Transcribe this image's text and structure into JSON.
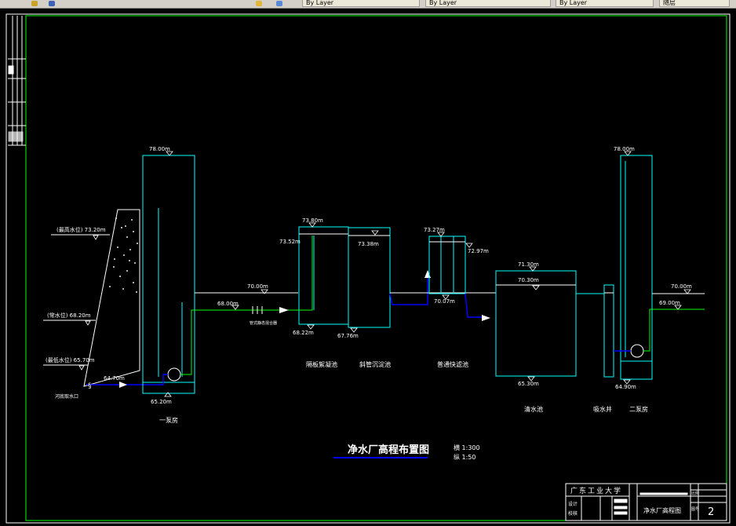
{
  "toolbar": {
    "tabs": [
      "By Layer",
      "By Layer",
      "By Layer",
      "随层"
    ],
    "icon_names": [
      "folder-icon",
      "save-icon",
      "layer-icon",
      "cube-icon"
    ]
  },
  "drawing": {
    "title": "净水厂高程布置图",
    "scale_h": "横 1:300",
    "scale_v": "纵 1:50",
    "river_levels": {
      "high": "(最高水位) 73.20m",
      "normal": "(常水位) 68.20m",
      "low": "(最低水位) 65.70m",
      "intake_label": "河底取水口"
    },
    "elevations": {
      "pump1_top": "78.00m",
      "pump1_bottom": "65.20m",
      "intake_water": "64.70m",
      "ground_left": "70.00m",
      "pipe_left": "68.00m",
      "pipe_label": "管式静态混合器",
      "floc_top": "73.80m",
      "floc_water": "73.52m",
      "floc_bottom": "68.22m",
      "sed_water": "73.38m",
      "sed_bottom": "67.76m",
      "filter_top": "73.27m",
      "filter_water": "72.97m",
      "filter_bottom": "70.07m",
      "clear_top": "71.30m",
      "clear_water": "70.30m",
      "clear_bottom": "65.30m",
      "pump2_top": "78.00m",
      "pump2_bottom": "64.90m",
      "ground_right": "70.00m",
      "pipe_right": "69.00m"
    },
    "unit_labels": {
      "pump1": "一泵房",
      "floc": "隔板絮凝池",
      "sed": "斜管沉淀池",
      "filter": "普通快滤池",
      "clear": "清水池",
      "well": "吸水井",
      "pump2": "二泵房"
    },
    "titleblock": {
      "school": "广东工业大学",
      "drawing_name": "净水厂高程图",
      "sheet_no": "2",
      "field_design": "设计",
      "field_check": "校核",
      "field_drawing_no": "图号",
      "field_scale": "比例"
    }
  },
  "colors": {
    "frame": "#00ff00",
    "structure": "#00ffff",
    "water_line": "#ffffff",
    "flow_pipe": "#0000ff",
    "text": "#ffffff",
    "label_yellow": "#ffff00"
  }
}
